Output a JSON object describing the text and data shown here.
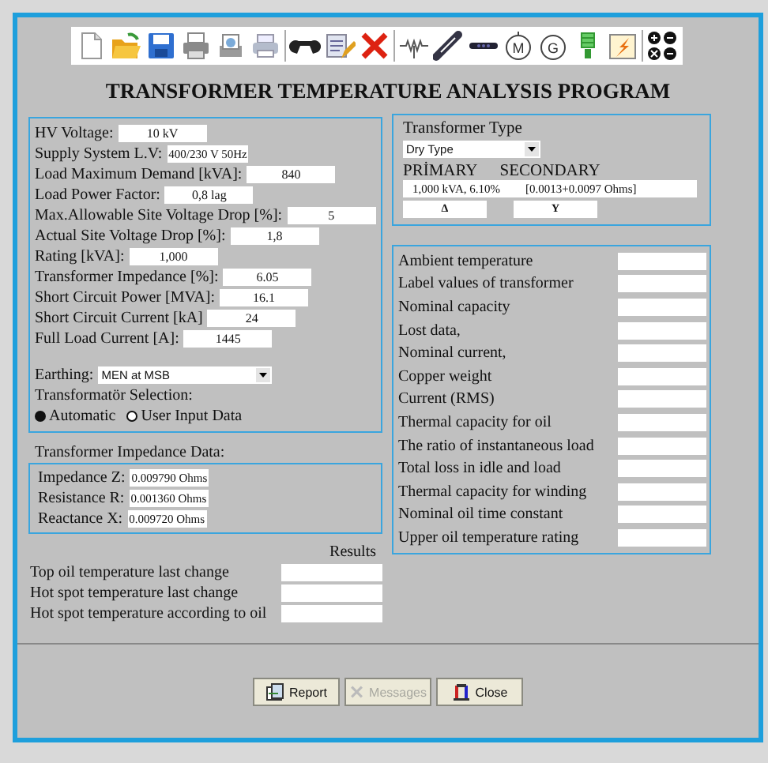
{
  "title": "TRANSFORMER TEMPERATURE ANALYSIS PROGRAM",
  "toolbar": {
    "motor_label": "M",
    "generator_label": "G"
  },
  "supply": {
    "fields": [
      {
        "label": "HV Voltage:",
        "value": "10 kV"
      },
      {
        "label": "Supply System L.V:",
        "value": "400/230 V 50Hz"
      },
      {
        "label": "Load Maximum Demand [kVA]:",
        "value": "840"
      },
      {
        "label": "Load Power Factor:",
        "value": "0,8 lag"
      },
      {
        "label": "Max.Allowable Site Voltage Drop [%]:",
        "value": "5"
      },
      {
        "label": "Actual Site Voltage Drop [%]:",
        "value": "1,8"
      },
      {
        "label": "Rating [kVA]:",
        "value": "1,000"
      },
      {
        "label": "Transformer Impedance [%]:",
        "value": "6.05"
      },
      {
        "label": "Short Circuit Power [MVA]:",
        "value": "16.1"
      },
      {
        "label": "Short Circuit Current [kA]",
        "value": "24"
      },
      {
        "label": "Full Load Current [A]:",
        "value": "1445"
      }
    ],
    "earthing": {
      "label": "Earthing:",
      "value": "MEN at MSB"
    },
    "selection": {
      "label": "Transformatör Selection:",
      "options": [
        {
          "label": "Automatic",
          "selected": true
        },
        {
          "label": "User Input Data",
          "selected": false
        }
      ]
    }
  },
  "impedance": {
    "title": "Transformer Impedance Data:",
    "fields": [
      {
        "label": "Impedance Z:",
        "value": "0.009790 Ohms"
      },
      {
        "label": "Resistance R:",
        "value": "0.001360 Ohms"
      },
      {
        "label": "Reactance X:",
        "value": "0.009720 Ohms"
      }
    ]
  },
  "results": {
    "heading": "Results",
    "rows": [
      {
        "label": "Top oil temperature last change"
      },
      {
        "label": "Hot spot temperature last change"
      },
      {
        "label": "Hot spot temperature according to oil"
      }
    ]
  },
  "transformer_type": {
    "title": "Transformer Type",
    "value": "Dry Type",
    "primary_label": "PRİMARY",
    "secondary_label": "SECONDARY",
    "rating": "1,000 kVA, 6.10%",
    "impedance": "[0.0013+0.0097 Ohms]",
    "primary_connection": "Δ",
    "secondary_connection": "Y"
  },
  "parameters": [
    {
      "label": "Ambient temperature"
    },
    {
      "label": "Label values of transformer"
    },
    {
      "label": "Nominal capacity"
    },
    {
      "label": "Lost data,"
    },
    {
      "label": "Nominal current,"
    },
    {
      "label": "Copper weight"
    },
    {
      "label": "Current (RMS)"
    },
    {
      "label": "Thermal capacity for oil"
    },
    {
      "label": "The ratio of instantaneous load"
    },
    {
      "label": "Total loss in idle and load"
    },
    {
      "label": "Thermal capacity for winding"
    },
    {
      "label": "Nominal oil time constant"
    },
    {
      "label": "Upper oil temperature rating"
    }
  ],
  "buttons": [
    {
      "label": "Report",
      "kind": "report",
      "disabled": false
    },
    {
      "label": "Messages",
      "kind": "messages",
      "disabled": true
    },
    {
      "label": "Close",
      "kind": "close",
      "disabled": false
    }
  ]
}
